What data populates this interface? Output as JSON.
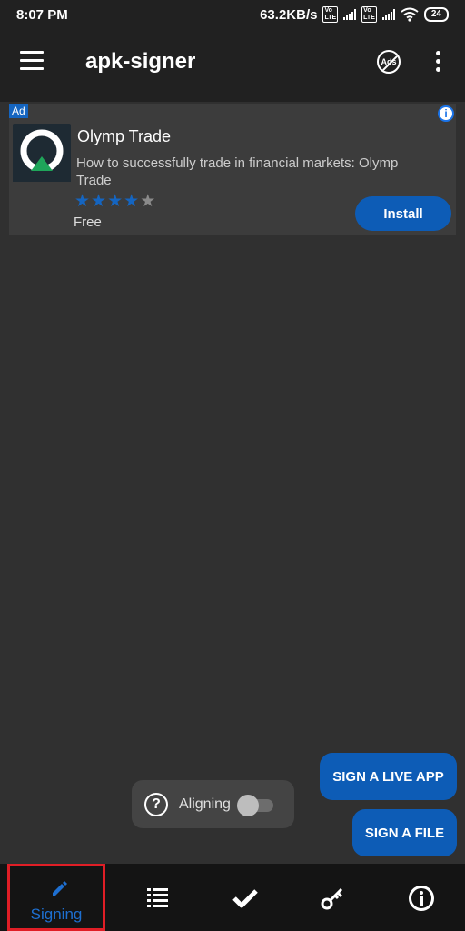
{
  "status_bar": {
    "time": "8:07 PM",
    "speed": "63.2KB/s",
    "volte1": "Vo LTE",
    "volte2": "Vo LTE",
    "battery": "24",
    "icons": [
      "signal-icon",
      "signal-icon",
      "wifi-icon",
      "battery-icon"
    ]
  },
  "app_bar": {
    "title": "apk-signer",
    "ads_label": "Ads",
    "icons": [
      "menu-icon",
      "remove-ads-icon",
      "more-vert-icon"
    ]
  },
  "ad": {
    "badge": "Ad",
    "info": "i",
    "title": "Olymp Trade",
    "description": "How to successfully trade in financial markets: Olymp Trade",
    "rating": 4,
    "rating_max": 5,
    "price": "Free",
    "install_label": "Install",
    "colors": {
      "accent": "#1565c0",
      "logo_bg": "#1e2a33",
      "logo_green": "#1fa55a"
    }
  },
  "aligning": {
    "help": "?",
    "label": "Aligning",
    "enabled": false
  },
  "actions": {
    "sign_live_app": "SIGN A LIVE APP",
    "sign_file": "SIGN A FILE"
  },
  "bottom_nav": {
    "items": [
      {
        "label": "Signing",
        "icon": "pencil-icon",
        "active": true
      },
      {
        "label": "",
        "icon": "list-icon",
        "active": false
      },
      {
        "label": "",
        "icon": "check-icon",
        "active": false
      },
      {
        "label": "",
        "icon": "key-icon",
        "active": false
      },
      {
        "label": "",
        "icon": "info-icon",
        "active": false
      }
    ]
  },
  "colors": {
    "background": "#303030",
    "bar": "#212121",
    "primary_button": "#0d5cb6",
    "active_tab": "#1e6fd0",
    "highlight_border": "#e01e26"
  }
}
